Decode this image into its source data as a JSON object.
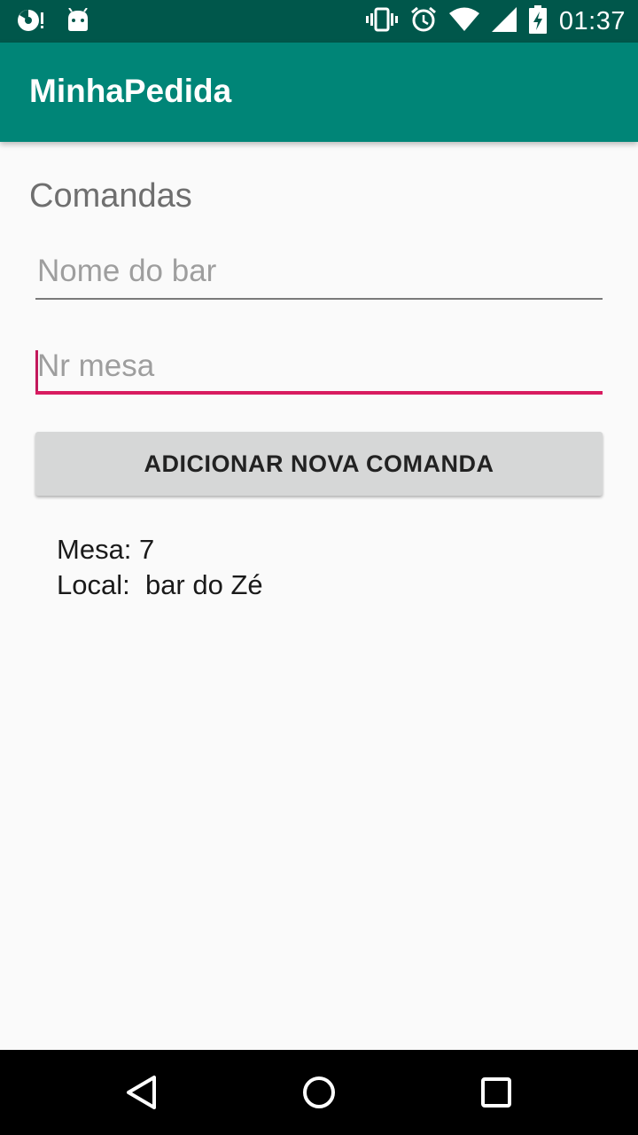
{
  "status_bar": {
    "time": "01:37",
    "left_icons": [
      "media-icon",
      "android-icon"
    ],
    "right_icons": [
      "vibrate-icon",
      "alarm-icon",
      "wifi-icon",
      "signal-icon",
      "battery-charging-icon"
    ]
  },
  "app_bar": {
    "title": "MinhaPedida",
    "color": "#008577"
  },
  "main": {
    "section_title": "Comandas",
    "bar_name_field": {
      "value": "",
      "placeholder": "Nome do bar"
    },
    "table_number_field": {
      "value": "",
      "placeholder": "Nr mesa"
    },
    "add_button_label": "ADICIONAR NOVA COMANDA",
    "entries": [
      {
        "mesa": "Mesa: 7",
        "local": "Local:  bar do Zé"
      }
    ]
  },
  "nav_bar": {
    "buttons": [
      "back-icon",
      "home-icon",
      "recent-apps-icon"
    ]
  },
  "colors": {
    "status_bar": "#00574b",
    "app_bar": "#008577",
    "accent": "#d81b60"
  }
}
